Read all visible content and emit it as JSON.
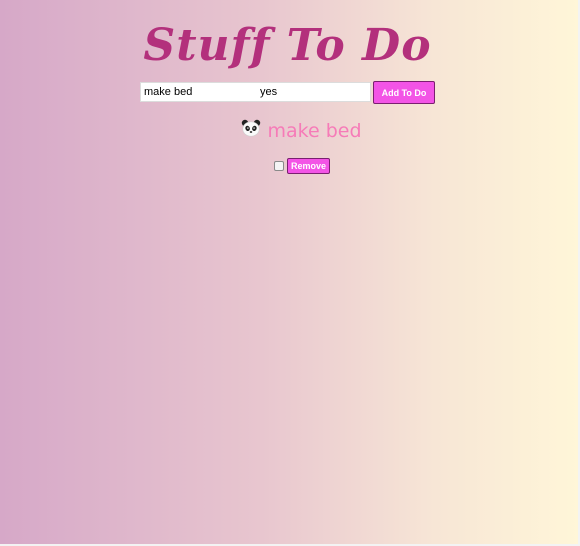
{
  "app": {
    "title": "Stuff To Do"
  },
  "form": {
    "task_value": "make bed",
    "done_value": "yes",
    "add_label": "Add To Do"
  },
  "todos": [
    {
      "icon": "panda-icon",
      "label": "make bed",
      "checked": false,
      "remove_label": "Remove"
    }
  ],
  "colors": {
    "title": "#b3307c",
    "button": "#f354e6",
    "item_text": "#f67bb8"
  }
}
